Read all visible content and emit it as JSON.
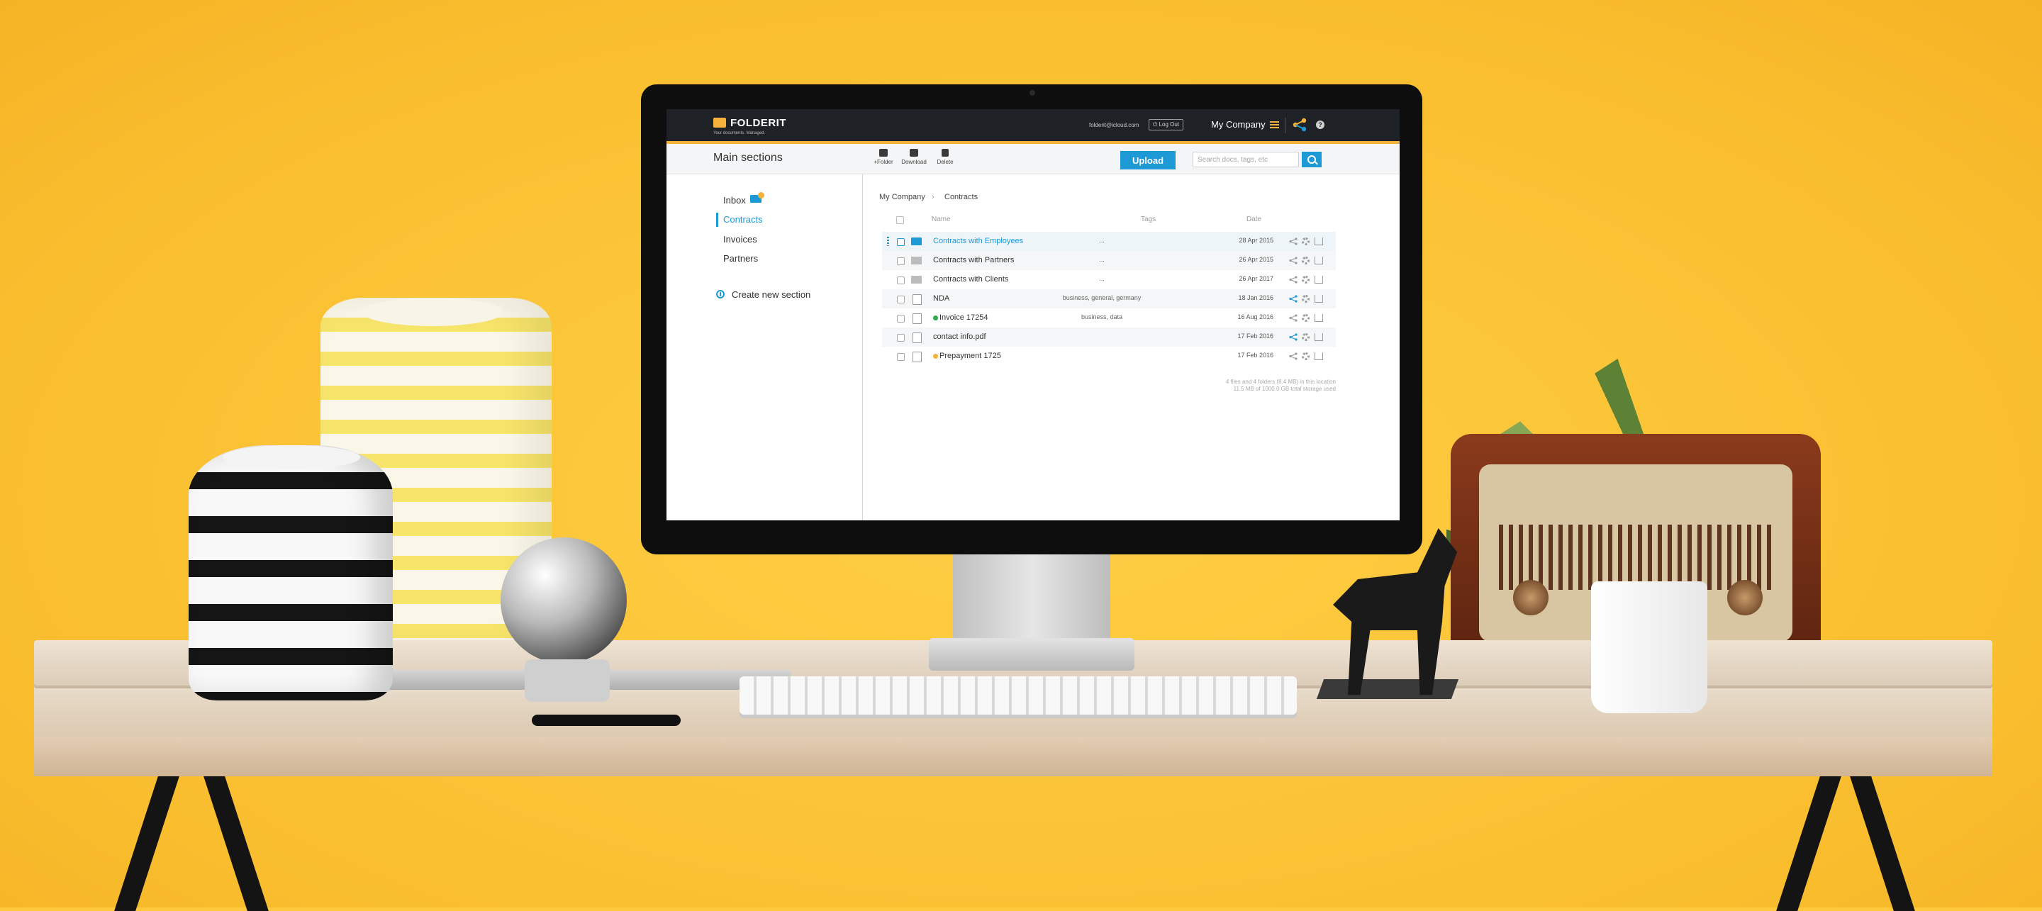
{
  "app": {
    "logo_text": "FOLDERIT",
    "logo_tagline": "Your documents. Managed.",
    "user_email": "folderit@icloud.com",
    "logout_label": "Log Out",
    "company": "My Company",
    "help": "?"
  },
  "subbar": {
    "title": "Main sections",
    "tools": [
      {
        "label": "+Folder",
        "icon": "folder-plus-icon"
      },
      {
        "label": "Download",
        "icon": "download-icon"
      },
      {
        "label": "Delete",
        "icon": "trash-icon"
      }
    ],
    "upload_label": "Upload",
    "search_placeholder": "Search docs, tags, etc"
  },
  "sidebar": {
    "items": [
      {
        "label": "Inbox",
        "active": false
      },
      {
        "label": "Contracts",
        "active": true
      },
      {
        "label": "Invoices",
        "active": false
      },
      {
        "label": "Partners",
        "active": false
      }
    ],
    "create_label": "Create new section"
  },
  "breadcrumb": [
    "My Company",
    "Contracts"
  ],
  "table": {
    "headers": {
      "name": "Name",
      "tags": "Tags",
      "date": "Date"
    },
    "rows": [
      {
        "name": "Contracts with Employees",
        "tags": "...",
        "date": "28 Apr 2015",
        "type": "folder",
        "selected": true
      },
      {
        "name": "Contracts with Partners",
        "tags": "...",
        "date": "26 Apr 2015",
        "type": "folder"
      },
      {
        "name": "Contracts with Clients",
        "tags": "...",
        "date": "26 Apr 2017",
        "type": "folder"
      },
      {
        "name": "NDA",
        "tags": "business, general, germany",
        "date": "18 Jan 2016",
        "type": "file",
        "shared": true
      },
      {
        "name": "Invoice 17254",
        "tags": "business, data",
        "date": "16 Aug 2016",
        "type": "file",
        "dot": "#2fa84f"
      },
      {
        "name": "contact info.pdf",
        "tags": "",
        "date": "17 Feb 2016",
        "type": "file",
        "shared": true
      },
      {
        "name": "Prepayment 1725",
        "tags": "",
        "date": "17 Feb 2016",
        "type": "doc",
        "dot": "#f4b23c"
      }
    ]
  },
  "footer": {
    "line1": "4 files and 4 folders (8.4 MB) in this location",
    "line2": "11.5 MB of 1000.0 GB total storage used"
  },
  "colors": {
    "accent": "#1d9ad6",
    "brand": "#f4b23c",
    "header": "#1e2125",
    "wall": "#ffc83d"
  }
}
